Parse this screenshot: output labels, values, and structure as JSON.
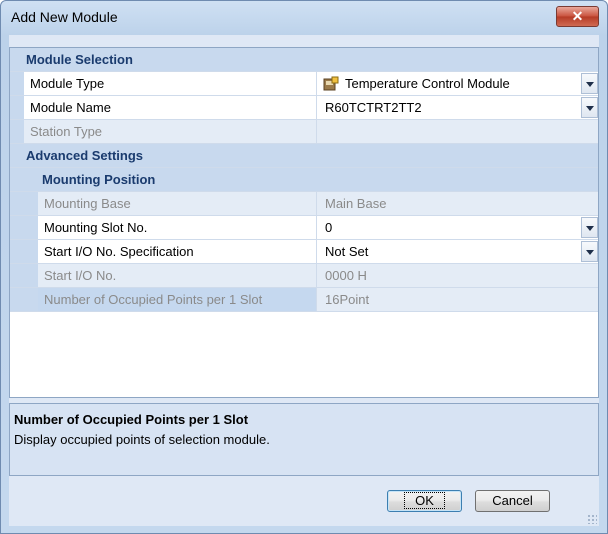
{
  "window": {
    "title": "Add New Module",
    "close_label": "✕"
  },
  "grid": {
    "module_selection": {
      "label": "Module Selection",
      "rows": [
        {
          "name": "Module Type",
          "value": "Temperature Control Module",
          "icon": "module-icon"
        },
        {
          "name": "Module Name",
          "value": "R60TCTRT2TT2"
        },
        {
          "name": "Station Type",
          "value": ""
        }
      ]
    },
    "advanced_settings": {
      "label": "Advanced Settings",
      "mounting_position": {
        "label": "Mounting Position",
        "rows": [
          {
            "name": "Mounting Base",
            "value": "Main Base"
          },
          {
            "name": "Mounting Slot No.",
            "value": "0"
          },
          {
            "name": "Start I/O No. Specification",
            "value": "Not Set"
          },
          {
            "name": "Start I/O No.",
            "value": "0000 H"
          },
          {
            "name": "Number of Occupied Points per 1 Slot",
            "value": "16Point"
          }
        ]
      }
    }
  },
  "description": {
    "title": "Number of Occupied Points per 1 Slot",
    "text": "Display occupied points of selection module."
  },
  "buttons": {
    "ok": "OK",
    "cancel": "Cancel"
  }
}
